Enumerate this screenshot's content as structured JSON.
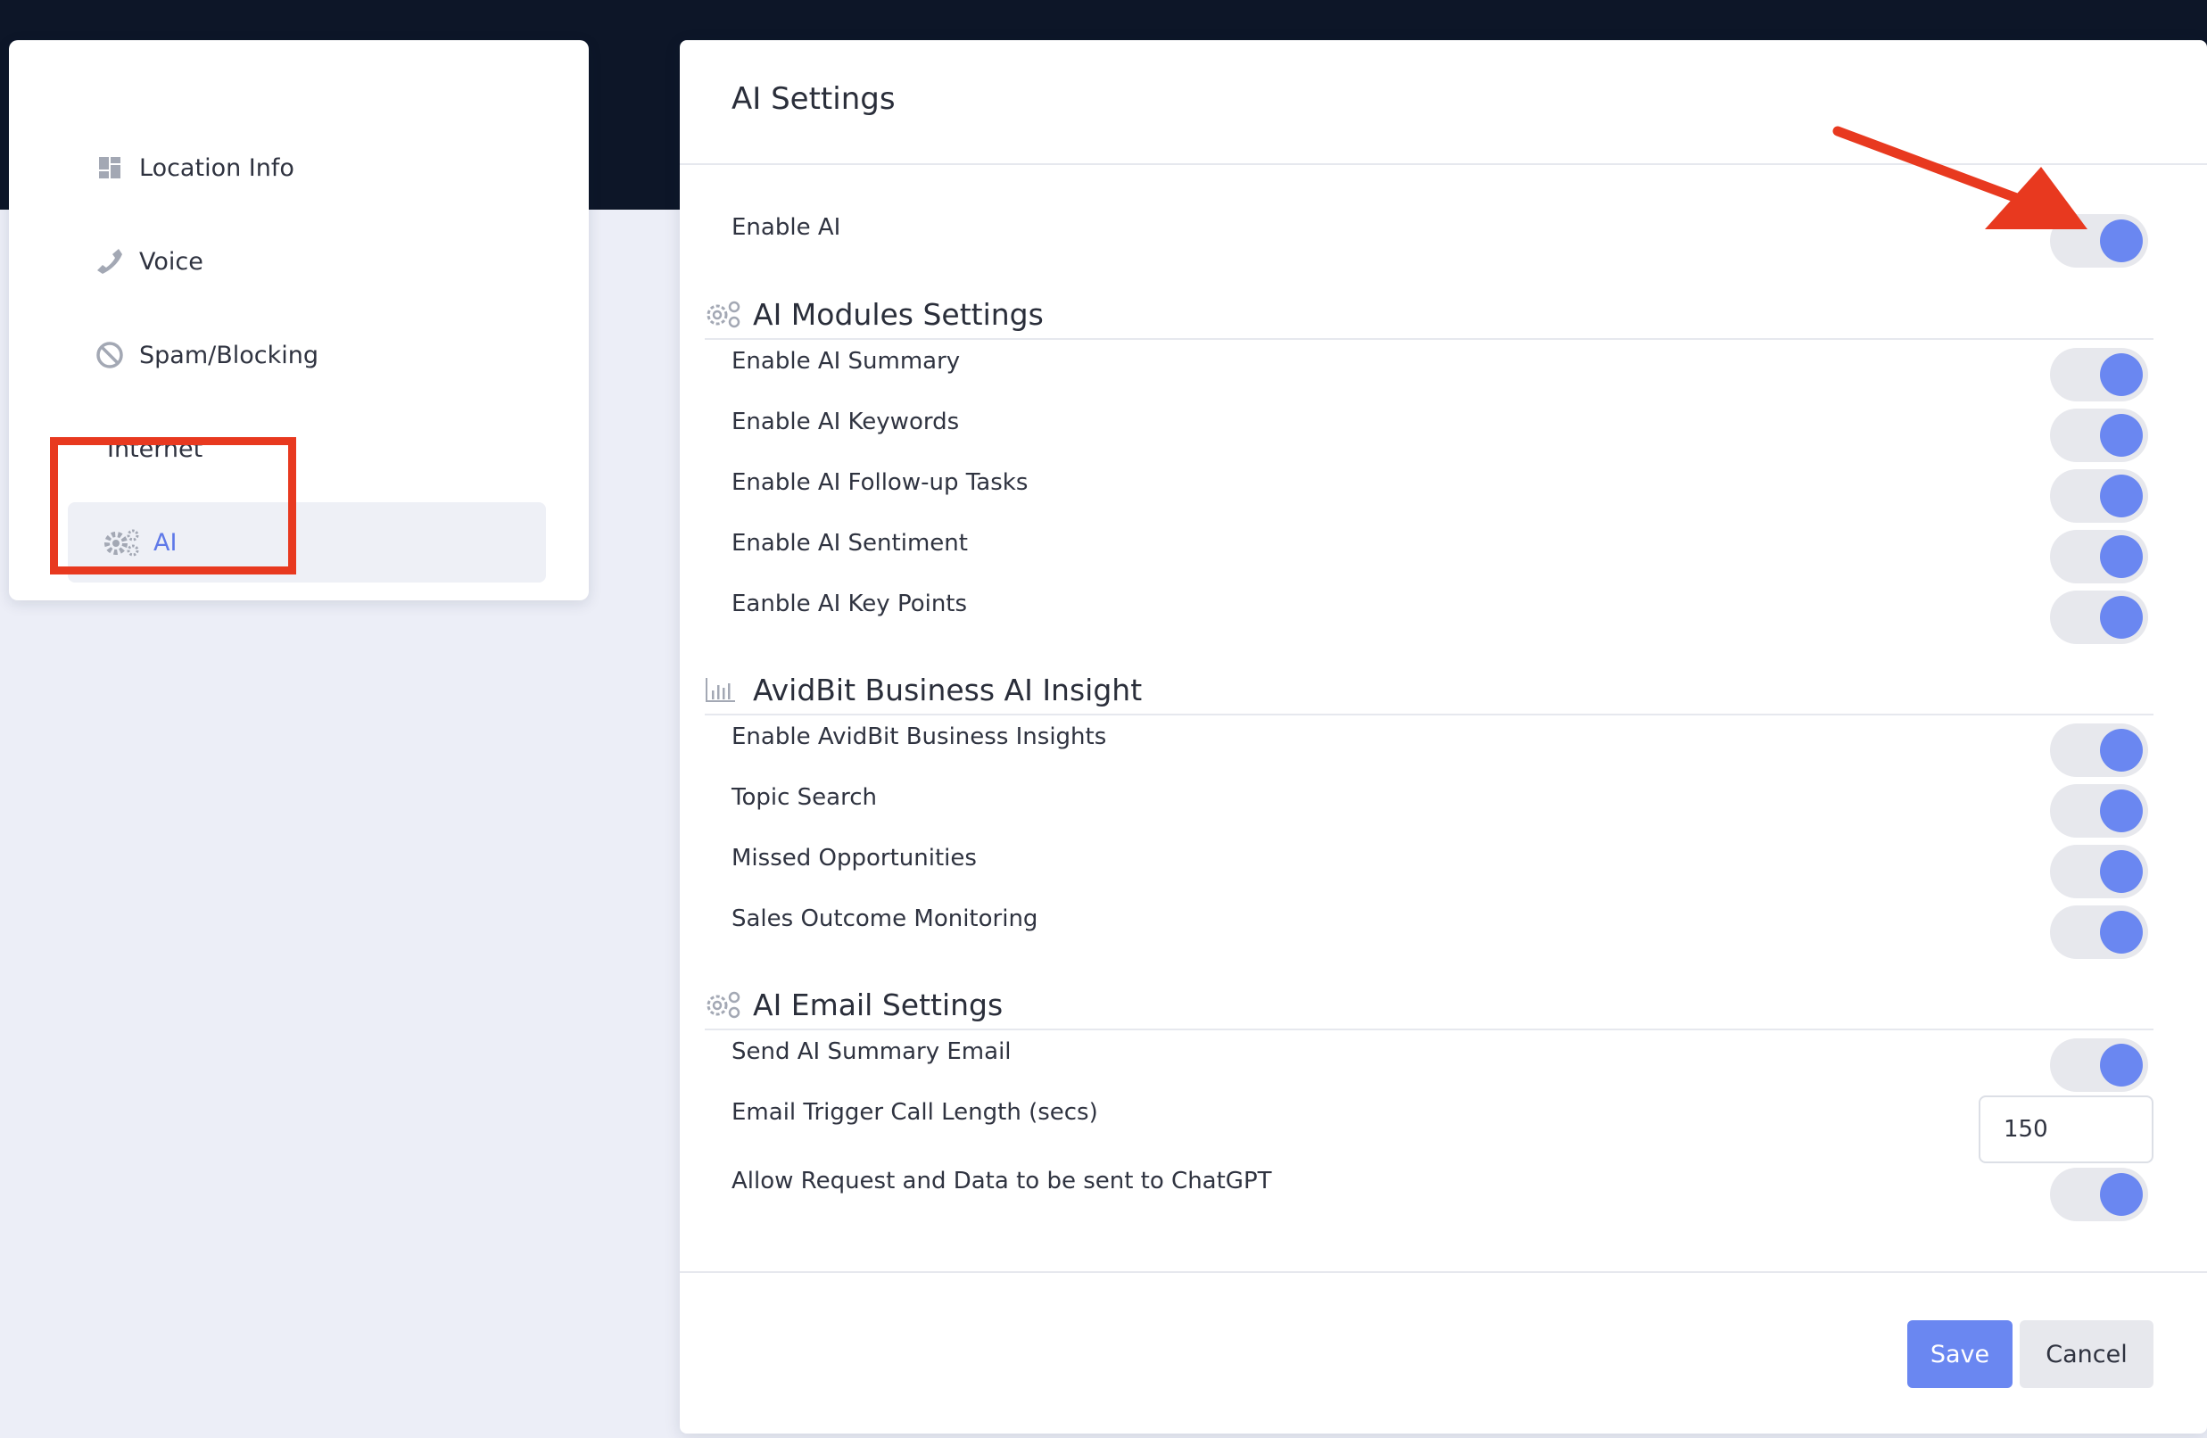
{
  "sidebar": {
    "items": [
      {
        "label": "Location Info",
        "icon": "grid-icon"
      },
      {
        "label": "Voice",
        "icon": "phone-icon"
      },
      {
        "label": "Spam/Blocking",
        "icon": "block-icon"
      }
    ],
    "section_heading": "Internet",
    "active_item": {
      "label": "AI",
      "icon": "gears-icon"
    }
  },
  "panel": {
    "title": "AI Settings",
    "enable_ai": {
      "label": "Enable AI",
      "on": true
    },
    "sections": [
      {
        "title": "AI Modules Settings",
        "icon": "gears-icon",
        "rows": [
          {
            "label": "Enable AI Summary",
            "on": true
          },
          {
            "label": "Enable AI Keywords",
            "on": true
          },
          {
            "label": "Enable AI Follow-up Tasks",
            "on": true
          },
          {
            "label": "Enable AI Sentiment",
            "on": true
          },
          {
            "label": "Eanble AI Key Points",
            "on": true
          }
        ]
      },
      {
        "title": "AvidBit Business AI Insight",
        "icon": "bar-chart-icon",
        "rows": [
          {
            "label": "Enable AvidBit Business Insights",
            "on": true
          },
          {
            "label": "Topic Search",
            "on": true
          },
          {
            "label": "Missed Opportunities",
            "on": true
          },
          {
            "label": "Sales Outcome Monitoring",
            "on": true
          }
        ]
      },
      {
        "title": "AI Email Settings",
        "icon": "gears-icon",
        "rows": [
          {
            "label": "Send AI Summary Email",
            "on": true
          },
          {
            "label": "Email Trigger Call Length (secs)",
            "value": "150"
          },
          {
            "label": "Allow Request and Data to be sent to ChatGPT",
            "on": true
          }
        ]
      }
    ],
    "buttons": {
      "save": "Save",
      "cancel": "Cancel"
    }
  },
  "colors": {
    "accent": "#6a87f1",
    "annotation_red": "#e8391f",
    "topbar": "#0d1628",
    "background": "#eceef7"
  }
}
